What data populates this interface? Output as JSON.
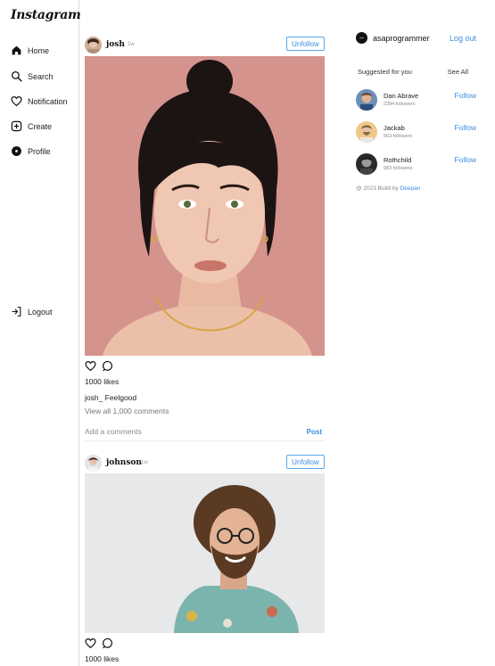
{
  "app": {
    "logo": "Instagram"
  },
  "sidebar": {
    "items": [
      {
        "label": "Home",
        "icon": "home-icon"
      },
      {
        "label": "Search",
        "icon": "search-icon"
      },
      {
        "label": "Notification",
        "icon": "heart-icon"
      },
      {
        "label": "Create",
        "icon": "plus-square-icon"
      },
      {
        "label": "Profile",
        "icon": "profile-icon"
      }
    ],
    "logout": {
      "label": "Logout",
      "icon": "logout-icon"
    }
  },
  "feed": {
    "posts": [
      {
        "username": "josh",
        "time": "1w",
        "unfollow_label": "Unfollow",
        "likes": "1000 likes",
        "caption": "josh_ Feelgood",
        "view_comments": "View all 1,000 comments",
        "comment_placeholder": "Add a comments",
        "post_label": "Post"
      },
      {
        "username": "johnson",
        "time": "1w",
        "unfollow_label": "Unfollow",
        "likes": "1000 likes"
      }
    ]
  },
  "right": {
    "me": {
      "username": "asaprogrammer",
      "logout_label": "Log out"
    },
    "suggestions_title": "Suggested for you",
    "see_all_label": "See All",
    "suggestions": [
      {
        "name": "Dan Abrave",
        "followers": "2394 followers",
        "follow_label": "Follow"
      },
      {
        "name": "Jackab",
        "followers": "563 followers",
        "follow_label": "Follow"
      },
      {
        "name": "Rothchild",
        "followers": "983 followers",
        "follow_label": "Follow"
      }
    ],
    "credit_prefix": "@ 2023 Build by",
    "credit_name": "Deepan"
  },
  "colors": {
    "accent": "#3a8ee0",
    "border": "#dbdbdb",
    "photo1_bg": "#d4938d",
    "photo2_bg": "#e6e8ea"
  }
}
